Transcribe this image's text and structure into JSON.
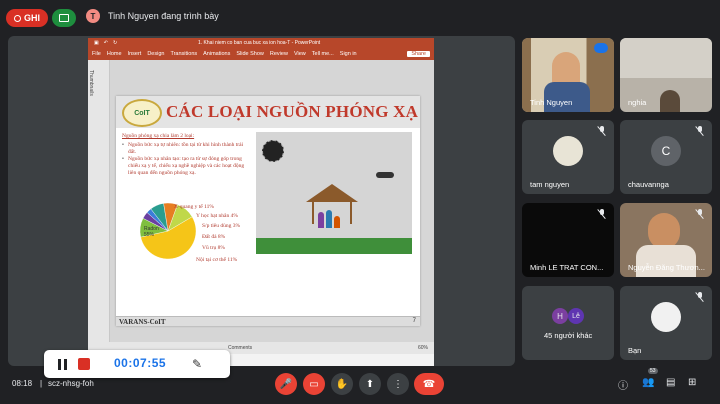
{
  "topbar": {
    "rec_label": "GHI",
    "presenter_initial": "T",
    "presenter_text": "Tinh Nguyen đang trình bày"
  },
  "ppt": {
    "window_title": "1. Khai niem co ban cua buc xa ion hoa-T - PowerPoint",
    "ribbon_tabs": [
      "File",
      "Home",
      "Insert",
      "Design",
      "Transitions",
      "Animations",
      "Slide Show",
      "Review",
      "View",
      "Tell me...",
      "Sign in",
      "Share"
    ],
    "thumbnails_label": "Thumbnails",
    "comments_label": "Comments",
    "zoom": "60%"
  },
  "slide": {
    "logo_text": "CoIT",
    "title": "CÁC LOẠI NGUỒN PHÓNG XẠ",
    "intro": "Nguồn phóng xạ chia làm 2 loại:",
    "bullet1": "Nguồn bức xạ tự nhiên: tồn tại từ khi hình thành trái đất.",
    "bullet2": "Nguồn bức xạ nhân tạo: tạo ra từ sự đóng góp trong chiếu xạ y tế, chiếu xạ nghề nghiệp và các hoạt động liên quan đến nguồn phóng xạ.",
    "pie_labels": [
      "X-quang y tế 11%",
      "Y học hạt nhân 4%",
      "S/p tiêu dùng 3%",
      "Đất đá 8%",
      "Vũ trụ 8%",
      "Nội tại cơ thể 11%"
    ],
    "radon_label": "Radon",
    "radon_value": "55%",
    "footer": "VARANS-CoIT",
    "page_number": "7"
  },
  "chart_data": {
    "type": "pie",
    "categories": [
      "Radon",
      "X-quang y tế",
      "Y học hạt nhân",
      "S/p tiêu dùng",
      "Đất đá",
      "Vũ trụ",
      "Nội tại cơ thể"
    ],
    "values": [
      55,
      11,
      4,
      3,
      8,
      8,
      11
    ],
    "colors": [
      "#f5c518",
      "#7fbf3f",
      "#6a3fa0",
      "#3b7dd8",
      "#2a9d8f",
      "#e67e22",
      "#c0d84a"
    ]
  },
  "timer": {
    "elapsed": "00:07:55"
  },
  "participants": [
    {
      "name": "Tinh Nguyen"
    },
    {
      "name": "nghia"
    },
    {
      "name": "tam nguyen"
    },
    {
      "name": "chauvannga",
      "initial": "C"
    },
    {
      "name": "Minh LE TRAT CON..."
    },
    {
      "name": "Nguyễn Đăng Thươn..."
    },
    {
      "name": "45 người khác",
      "initial1": "H",
      "initial2": "Lê"
    },
    {
      "name": "Bạn"
    }
  ],
  "bottombar": {
    "time": "08:18",
    "meeting_code": "scz-nhsg-foh",
    "participant_count": "53"
  }
}
